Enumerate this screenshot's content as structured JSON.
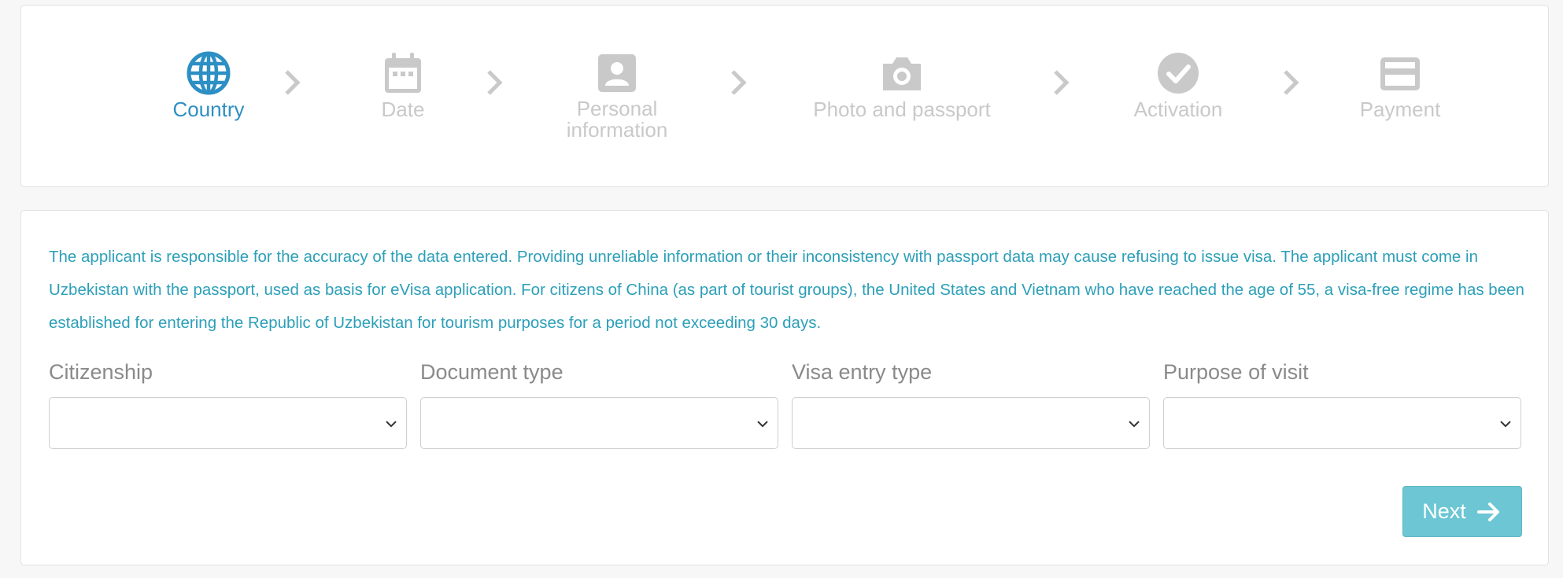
{
  "steps": [
    {
      "label": "Country",
      "icon": "globe-icon",
      "active": true
    },
    {
      "label": "Date",
      "icon": "calendar-icon",
      "active": false
    },
    {
      "label": "Personal information",
      "label_line1": "Personal",
      "label_line2": "information",
      "icon": "person-badge-icon",
      "active": false
    },
    {
      "label": "Photo and passport",
      "icon": "camera-icon",
      "active": false
    },
    {
      "label": "Activation",
      "icon": "check-circle-icon",
      "active": false
    },
    {
      "label": "Payment",
      "icon": "credit-card-icon",
      "active": false
    }
  ],
  "notice": "The applicant is responsible for the accuracy of the data entered. Providing unreliable information or their inconsistency with passport data may cause refusing to issue visa. The applicant must come in Uzbekistan with the passport, used as basis for eVisa application. For citizens of China (as part of tourist groups), the United States and Vietnam who have reached the age of 55, a visa-free regime has been established for entering the Republic of Uzbekistan for tourism purposes for a period not exceeding 30 days.",
  "fields": [
    {
      "label": "Citizenship",
      "value": ""
    },
    {
      "label": "Document type",
      "value": ""
    },
    {
      "label": "Visa entry type",
      "value": ""
    },
    {
      "label": "Purpose of visit",
      "value": ""
    }
  ],
  "next_label": "Next",
  "colors": {
    "active": "#2d8fc3",
    "inactive": "#c9c9c9",
    "notice_text": "#2c9fb8",
    "button_bg": "#6cc6d4"
  }
}
